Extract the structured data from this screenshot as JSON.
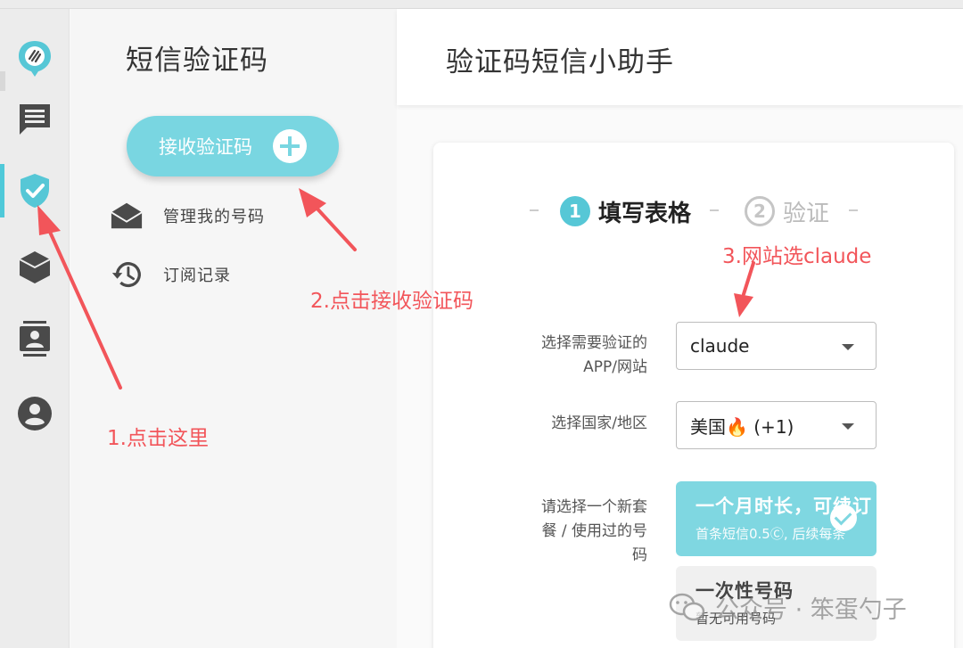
{
  "sidebar": {
    "title": "短信验证码",
    "receive_button_label": "接收验证码",
    "items": [
      {
        "label": "管理我的号码",
        "icon": "envelope-open-icon"
      },
      {
        "label": "订阅记录",
        "icon": "history-icon"
      }
    ]
  },
  "rail": {
    "icons": [
      "logo-icon",
      "message-icon",
      "shield-check-icon",
      "cube-icon",
      "contacts-icon",
      "account-icon"
    ],
    "active_index": 2
  },
  "header": {
    "title": "验证码短信小助手"
  },
  "steps": [
    {
      "number": "1",
      "label": "填写表格",
      "active": true
    },
    {
      "number": "2",
      "label": "验证",
      "active": false
    }
  ],
  "form": {
    "app_label_line1": "选择需要验证的",
    "app_label_line2": "APP/网站",
    "app_value": "claude",
    "country_label": "选择国家/地区",
    "country_value": "美国🔥 (+1)",
    "plan_label_line1": "请选择一个新套",
    "plan_label_line2": "餐 / 使用过的号",
    "plan_label_line3": "码",
    "plans": [
      {
        "title": "一个月时长，可续订",
        "subtitle": "首条短信0.5Ⓒ, 后续每条",
        "selected": true
      },
      {
        "title": "一次性号码",
        "subtitle": "暂无可用号码",
        "selected": false
      }
    ]
  },
  "annotations": {
    "step1": "1.点击这里",
    "step2": "2.点击接收验证码",
    "step3": "3.网站选claude"
  },
  "watermark": {
    "text": "公众号 · 笨蛋勺子"
  },
  "colors": {
    "accent": "#56c7d6",
    "annotation": "#f2555a",
    "plan_active": "#7fd7e1"
  }
}
